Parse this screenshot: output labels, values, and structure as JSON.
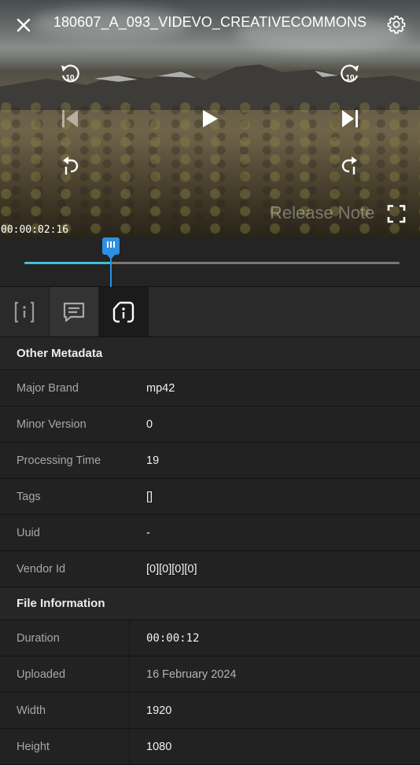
{
  "player": {
    "title": "180607_A_093_VIDEVO_CREATIVECOMMONS",
    "timecode": "00:00:02:16",
    "overlay_text": "Release Note",
    "progress": 0.23,
    "icons": {
      "close": "close-icon",
      "settings": "gear-icon",
      "rewind10": "rewind-10-icon",
      "forward10": "forward-10-icon",
      "prev": "skip-previous-icon",
      "play": "play-icon",
      "next": "skip-next-icon",
      "undo": "undo-icon",
      "redo": "redo-icon",
      "fullscreen": "fullscreen-icon"
    },
    "colors": {
      "accent": "#2f8fe0",
      "progress": "#3ec3d6"
    }
  },
  "tabs": [
    {
      "name": "info",
      "icon": "info-bracket-icon",
      "active": false
    },
    {
      "name": "comments",
      "icon": "comment-icon",
      "active": false
    },
    {
      "name": "metadata",
      "icon": "metadata-icon",
      "active": true
    }
  ],
  "other_metadata": {
    "title": "Other Metadata",
    "rows": [
      {
        "key": "Major Brand",
        "value": "mp42"
      },
      {
        "key": "Minor Version",
        "value": "0"
      },
      {
        "key": "Processing Time",
        "value": "19"
      },
      {
        "key": "Tags",
        "value": "[]"
      },
      {
        "key": "Uuid",
        "value": "-"
      },
      {
        "key": "Vendor Id",
        "value": "[0][0][0][0]"
      }
    ]
  },
  "file_information": {
    "title": "File Information",
    "rows": [
      {
        "key": "Duration",
        "value": "00:00:12"
      },
      {
        "key": "Uploaded",
        "value": "16 February 2024"
      },
      {
        "key": "Width",
        "value": "1920"
      },
      {
        "key": "Height",
        "value": "1080"
      }
    ]
  }
}
